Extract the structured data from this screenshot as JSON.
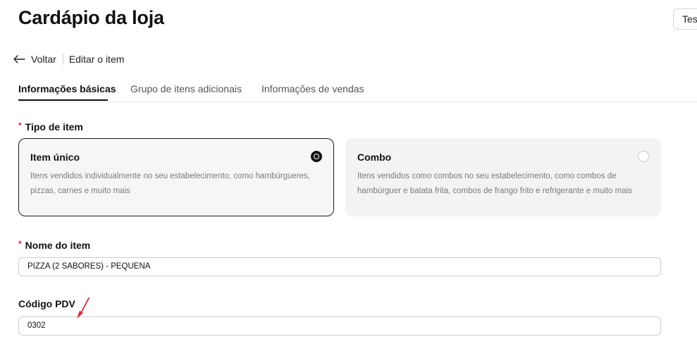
{
  "header": {
    "title": "Cardápio da loja",
    "top_right_button": "Tes"
  },
  "breadcrumb": {
    "back_label": "Voltar",
    "current": "Editar o item"
  },
  "tabs": [
    {
      "label": "Informações básicas",
      "active": true
    },
    {
      "label": "Grupo de itens adicionais",
      "active": false
    },
    {
      "label": "Informações de vendas",
      "active": false
    }
  ],
  "item_type": {
    "required_mark": "*",
    "label": "Tipo de item",
    "options": [
      {
        "title": "Item único",
        "description": "Itens vendidos individualmente no seu estabelecimento, como hambúrgueres, pizzas, carnes e muito mais",
        "selected": true
      },
      {
        "title": "Combo",
        "description": "Itens vendidos como combos no seu estabelecimento, como combos de hambúrguer e batata frita, combos de frango frito e refrigerante e muito mais",
        "selected": false
      }
    ]
  },
  "item_name": {
    "required_mark": "*",
    "label": "Nome do item",
    "value": "PIZZA (2 SABORES) - PEQUENA"
  },
  "pdv_code": {
    "label": "Código PDV",
    "value": "0302"
  },
  "colors": {
    "required": "#e3262f",
    "annotation": "#e3262f",
    "text": "#111111",
    "selected_border": "#1b1b1b"
  },
  "icons": {
    "back": "arrow-left-icon",
    "annotation": "red-arrow-icon"
  }
}
